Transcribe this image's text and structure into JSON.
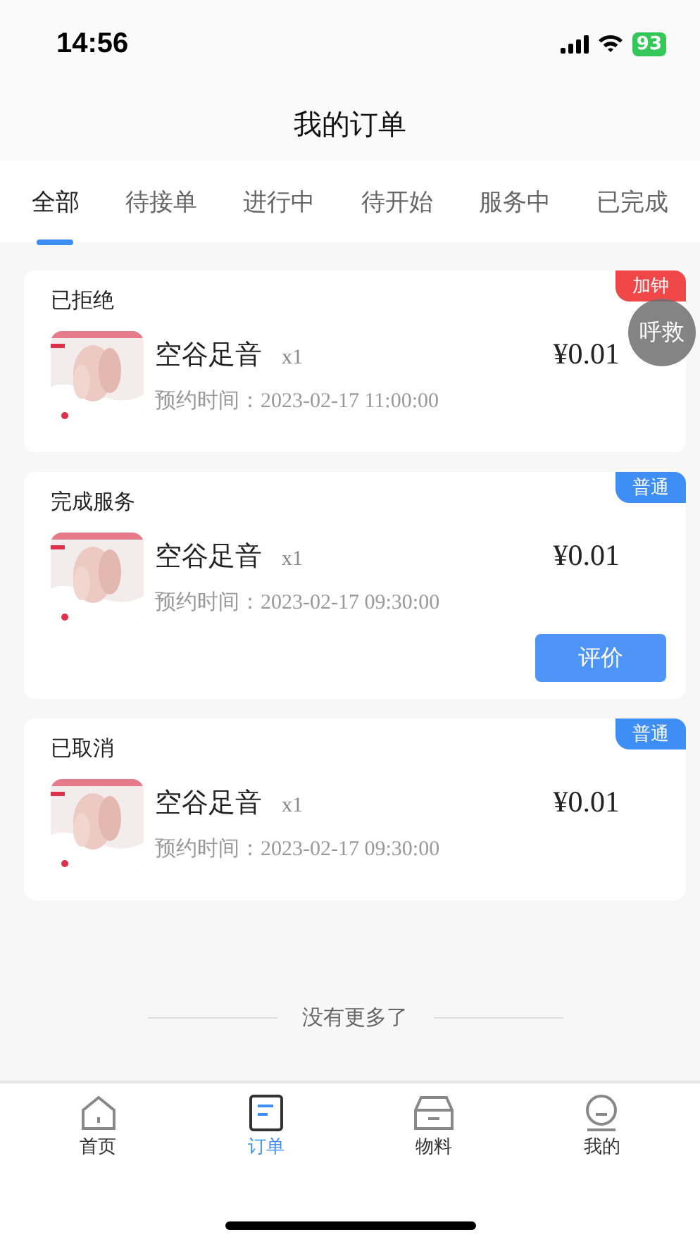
{
  "status_bar": {
    "time": "14:56",
    "battery": "93"
  },
  "title": "我的订单",
  "tabs": [
    {
      "label": "全部",
      "selected": true
    },
    {
      "label": "待接单",
      "selected": false
    },
    {
      "label": "进行中",
      "selected": false
    },
    {
      "label": "待开始",
      "selected": false
    },
    {
      "label": "服务中",
      "selected": false
    },
    {
      "label": "已完成",
      "selected": false
    }
  ],
  "orders": [
    {
      "status": "已拒绝",
      "tag": "加钟",
      "color": "#f04848",
      "name": "空谷足音",
      "qty": "x1",
      "time_label": "预约时间：",
      "time": "2023-02-17 11:00:00",
      "price": "¥0.01"
    },
    {
      "status": "完成服务",
      "tag": "普通",
      "color": "#3f8ef5",
      "name": "空谷足音",
      "qty": "x1",
      "time_label": "预约时间：",
      "time": "2023-02-17 09:30:00",
      "price": "¥0.01",
      "button": "评价"
    },
    {
      "status": "已取消",
      "tag": "普通",
      "color": "#3f8ef5",
      "name": "空谷足音",
      "qty": "x1",
      "time_label": "预约时间：",
      "time": "2023-02-17 09:30:00",
      "price": "¥0.01"
    }
  ],
  "floating_button": "呼救",
  "end_note": "没有更多了",
  "nav": [
    {
      "label": "首页",
      "kind": "home",
      "selected": false
    },
    {
      "label": "订单",
      "kind": "orders",
      "selected": true
    },
    {
      "label": "物料",
      "kind": "box",
      "selected": false
    },
    {
      "label": "我的",
      "kind": "me",
      "selected": false
    }
  ]
}
